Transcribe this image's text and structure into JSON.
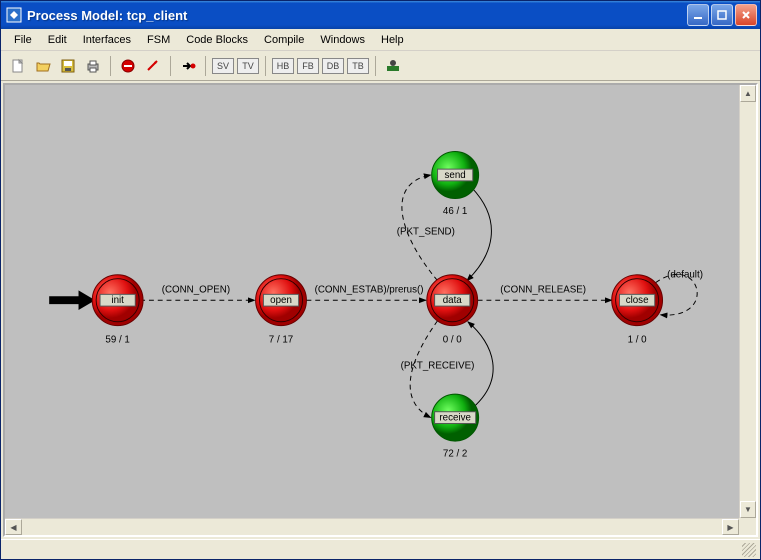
{
  "window": {
    "title": "Process Model: tcp_client"
  },
  "menu": {
    "file": "File",
    "edit": "Edit",
    "interfaces": "Interfaces",
    "fsm": "FSM",
    "code_blocks": "Code Blocks",
    "compile": "Compile",
    "windows": "Windows",
    "help": "Help"
  },
  "toolbar": {
    "sv": "SV",
    "tv": "TV",
    "hb": "HB",
    "fb": "FB",
    "db": "DB",
    "tb": "TB"
  },
  "states": {
    "init": {
      "label": "init",
      "stats": "59 / 1"
    },
    "open": {
      "label": "open",
      "stats": "7 / 17"
    },
    "data": {
      "label": "data",
      "stats": "0 / 0"
    },
    "send": {
      "label": "send",
      "stats": "46 / 1"
    },
    "receive": {
      "label": "receive",
      "stats": "72 / 2"
    },
    "close": {
      "label": "close",
      "stats": "1 / 0"
    }
  },
  "transitions": {
    "init_open": "(CONN_OPEN)",
    "open_data": "(CONN_ESTAB)/prerus()",
    "data_send": "(PKT_SEND)",
    "data_receive": "(PKT_RECEIVE)",
    "data_close": "(CONN_RELEASE)",
    "close_self": "(default)"
  },
  "chart_data": {
    "type": "state-diagram",
    "states": [
      {
        "id": "init",
        "kind": "forced",
        "color": "red",
        "initial": true,
        "enter_exec": 59,
        "exit_exec": 1
      },
      {
        "id": "open",
        "kind": "forced",
        "color": "red",
        "initial": false,
        "enter_exec": 7,
        "exit_exec": 17
      },
      {
        "id": "data",
        "kind": "forced",
        "color": "red",
        "initial": false,
        "enter_exec": 0,
        "exit_exec": 0
      },
      {
        "id": "send",
        "kind": "unforced",
        "color": "green",
        "initial": false,
        "enter_exec": 46,
        "exit_exec": 1
      },
      {
        "id": "receive",
        "kind": "unforced",
        "color": "green",
        "initial": false,
        "enter_exec": 72,
        "exit_exec": 2
      },
      {
        "id": "close",
        "kind": "forced",
        "color": "red",
        "initial": false,
        "enter_exec": 1,
        "exit_exec": 0
      }
    ],
    "transitions": [
      {
        "from": "init",
        "to": "open",
        "condition": "CONN_OPEN",
        "dashed": true
      },
      {
        "from": "open",
        "to": "data",
        "condition": "CONN_ESTAB",
        "executive": "prerus()",
        "dashed": true
      },
      {
        "from": "data",
        "to": "send",
        "condition": "PKT_SEND",
        "dashed": true
      },
      {
        "from": "send",
        "to": "data",
        "condition": null,
        "dashed": false
      },
      {
        "from": "data",
        "to": "receive",
        "condition": "PKT_RECEIVE",
        "dashed": true
      },
      {
        "from": "receive",
        "to": "data",
        "condition": null,
        "dashed": false
      },
      {
        "from": "data",
        "to": "close",
        "condition": "CONN_RELEASE",
        "dashed": true
      },
      {
        "from": "close",
        "to": "close",
        "condition": "default",
        "dashed": true
      }
    ]
  }
}
